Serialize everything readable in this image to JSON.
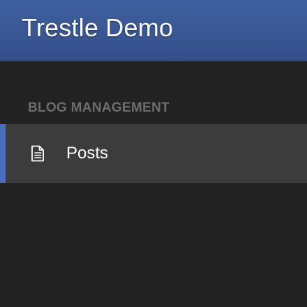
{
  "header": {
    "title": "Trestle Demo"
  },
  "navigation": {
    "sections": [
      {
        "title": "BLOG MANAGEMENT",
        "items": [
          {
            "label": "Posts",
            "icon": "document-icon",
            "active": true
          }
        ]
      }
    ]
  },
  "colors": {
    "header_background": "#3a5795",
    "sidebar_background": "#222222",
    "active_item_background": "#3c3c3c",
    "active_indicator": "#4a6dbf",
    "section_title": "#6d6d6d",
    "text": "#ffffff"
  }
}
